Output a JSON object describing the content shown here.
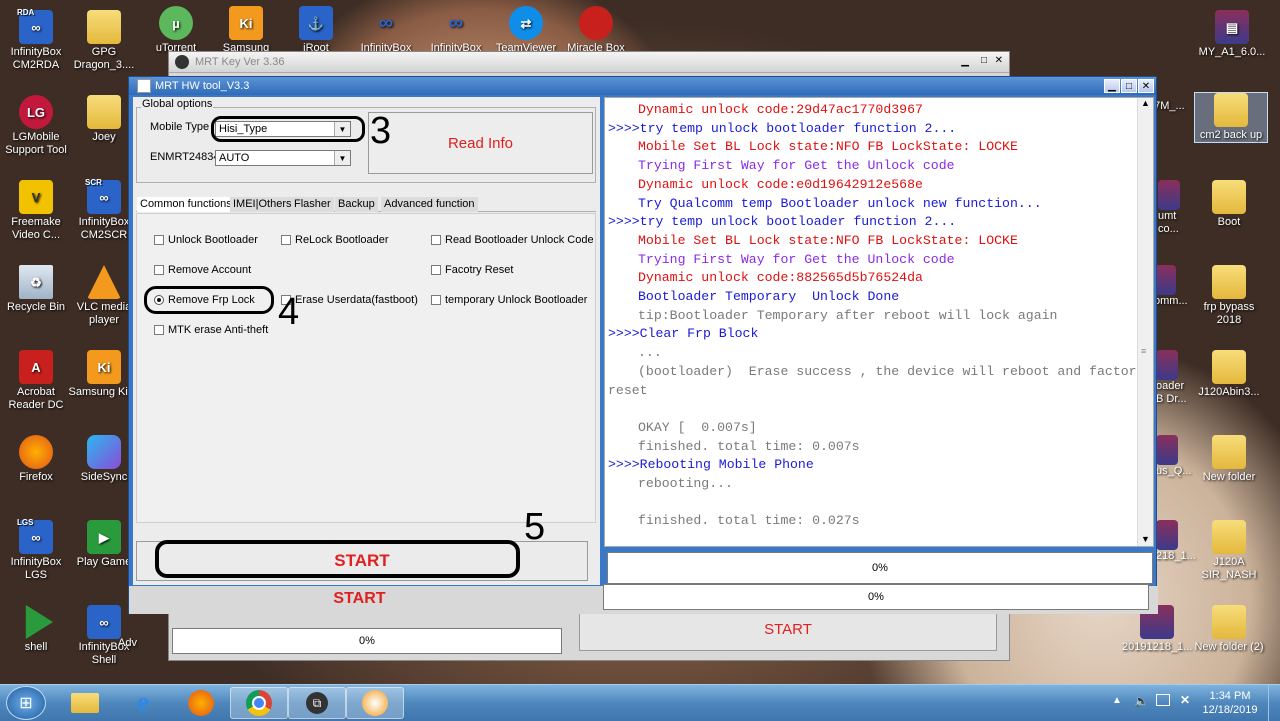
{
  "desktop": {
    "left_icons": [
      {
        "id": "infinitybox-cm2rda",
        "label": "InfinityBox CM2RDA",
        "badge": "RDA"
      },
      {
        "id": "gpg-dragon",
        "label": "GPG Dragon_3....",
        "badge": ""
      },
      {
        "id": "lgmobile",
        "label": "LGMobile Support Tool",
        "badge": ""
      },
      {
        "id": "joey",
        "label": "Joey",
        "badge": ""
      },
      {
        "id": "freemake",
        "label": "Freemake Video C...",
        "badge": ""
      },
      {
        "id": "infinitybox-cm2scr",
        "label": "InfinityBox CM2SCR",
        "badge": "SCR"
      },
      {
        "id": "recycle-bin",
        "label": "Recycle Bin",
        "badge": ""
      },
      {
        "id": "vlc",
        "label": "VLC media player",
        "badge": ""
      },
      {
        "id": "acrobat",
        "label": "Acrobat Reader DC",
        "badge": ""
      },
      {
        "id": "samsung-kies",
        "label": "Samsung Kies",
        "badge": ""
      },
      {
        "id": "firefox",
        "label": "Firefox",
        "badge": ""
      },
      {
        "id": "sidesync",
        "label": "SideSync",
        "badge": ""
      },
      {
        "id": "infinitybox-lgs",
        "label": "InfinityBox LGS",
        "badge": "LGS"
      },
      {
        "id": "play-games",
        "label": "Play Game",
        "badge": ""
      },
      {
        "id": "shell",
        "label": "shell",
        "badge": ""
      },
      {
        "id": "infinitybox-shell",
        "label": "InfinityBox Shell",
        "badge": ""
      }
    ],
    "top_icons": [
      {
        "id": "utorrent",
        "label": "uTorrent"
      },
      {
        "id": "samsung",
        "label": "Samsung"
      },
      {
        "id": "iroot",
        "label": "iRoot"
      },
      {
        "id": "infinitybox-qlm",
        "label": "InfinityBox"
      },
      {
        "id": "infinitybox-2",
        "label": "InfinityBox"
      },
      {
        "id": "teamviewer",
        "label": "TeamViewer"
      },
      {
        "id": "miracle-box",
        "label": "Miracle Box"
      }
    ],
    "right_icons": [
      {
        "id": "my-a1",
        "label": "MY_A1_6.0..."
      },
      {
        "id": "cm2-back-up",
        "label": "cm2 back up"
      },
      {
        "id": "boot",
        "label": "Boot"
      },
      {
        "id": "frp-bypass",
        "label": "frp bypass 2018"
      },
      {
        "id": "j120abin",
        "label": "J120Abin3..."
      },
      {
        "id": "new-folder",
        "label": "New folder"
      },
      {
        "id": "j120a-sir-nash",
        "label": "J120A SIR_NASH"
      },
      {
        "id": "new-folder-2",
        "label": "New folder (2)"
      }
    ],
    "partial_labels": {
      "p1": "37M_...",
      "p2": "umt",
      "p3": "co...",
      "p4": "omm...",
      "p5": "oader",
      "p6": "B Dr...",
      "p7": "us_Q...",
      "p8": "218_1...",
      "p9": "20191218_1...",
      "p10": "Adv"
    }
  },
  "back_window": {
    "title": "MRT Key Ver 3.36",
    "start_label": "START",
    "progress_left": "0%",
    "progress_right": "0%",
    "start_right_label": "START"
  },
  "main_window": {
    "title": "MRT HW tool_V3.3",
    "global_options_label": "Global options",
    "mobile_type_label": "Mobile Type",
    "mobile_type_value": "Hisi_Type",
    "enmrt_label": "ENMRT24834",
    "enmrt_value": "AUTO",
    "read_info_label": "Read Info",
    "tabs": [
      "Common functions",
      "IMEI|Others",
      "Flasher",
      "Backup",
      "Advanced function"
    ],
    "options": {
      "unlock_bootloader": "Unlock Bootloader",
      "relock_bootloader": "ReLock Bootloader",
      "read_bootloader_code": "Read Bootloader Unlock Code",
      "remove_account": "Remove Account",
      "factory_reset": "Facotry Reset",
      "remove_frp_lock": "Remove Frp Lock",
      "erase_userdata": "Erase Userdata(fastboot)",
      "temp_unlock_bootloader": "temporary Unlock Bootloader",
      "mtk_erase": "MTK erase Anti-theft"
    },
    "start_label": "START",
    "progress": "0%",
    "annotations": [
      "3",
      "4",
      "5"
    ],
    "log": [
      {
        "t": "Dynamic unlock code:29d47ac1770d3967",
        "c": "red",
        "i": true
      },
      {
        "t": ">>>>try temp unlock bootloader function 2...",
        "c": "blue",
        "i": false
      },
      {
        "t": "Mobile Set BL Lock state:NFO FB LockState: LOCKE",
        "c": "red",
        "i": true
      },
      {
        "t": "Trying First Way for Get the Unlock code",
        "c": "purple",
        "i": true
      },
      {
        "t": "Dynamic unlock code:e0d19642912e568e",
        "c": "red",
        "i": true
      },
      {
        "t": "Try Qualcomm temp Bootloader unlock new function...",
        "c": "blue",
        "i": true
      },
      {
        "t": ">>>>try temp unlock bootloader function 2...",
        "c": "blue",
        "i": false
      },
      {
        "t": "Mobile Set BL Lock state:NFO FB LockState: LOCKE",
        "c": "red",
        "i": true
      },
      {
        "t": "Trying First Way for Get the Unlock code",
        "c": "purple",
        "i": true
      },
      {
        "t": "Dynamic unlock code:882565d5b76524da",
        "c": "red",
        "i": true
      },
      {
        "t": "Bootloader Temporary  Unlock Done",
        "c": "blue",
        "i": true
      },
      {
        "t": "tip:Bootloader Temporary after reboot will lock again",
        "c": "gray",
        "i": true
      },
      {
        "t": ">>>>Clear Frp Block",
        "c": "blue",
        "i": false
      },
      {
        "t": "...",
        "c": "gray",
        "i": true
      },
      {
        "t": "(bootloader)  Erase success , the device will reboot and factory",
        "c": "gray",
        "i": true
      },
      {
        "t": "reset",
        "c": "gray",
        "i": false
      },
      {
        "t": "",
        "c": "gray",
        "i": true
      },
      {
        "t": "OKAY [  0.007s]",
        "c": "gray",
        "i": true
      },
      {
        "t": "finished. total time: 0.007s",
        "c": "gray",
        "i": true
      },
      {
        "t": ">>>>Rebooting Mobile Phone",
        "c": "blue",
        "i": false
      },
      {
        "t": "rebooting...",
        "c": "gray",
        "i": true
      },
      {
        "t": "",
        "c": "gray",
        "i": true
      },
      {
        "t": "finished. total time: 0.027s",
        "c": "gray",
        "i": true
      }
    ]
  },
  "taskbar": {
    "time": "1:34 PM",
    "date": "12/18/2019",
    "apps": [
      "explorer",
      "internet-explorer",
      "firefox",
      "chrome",
      "task-view",
      "mrt-tool"
    ]
  }
}
